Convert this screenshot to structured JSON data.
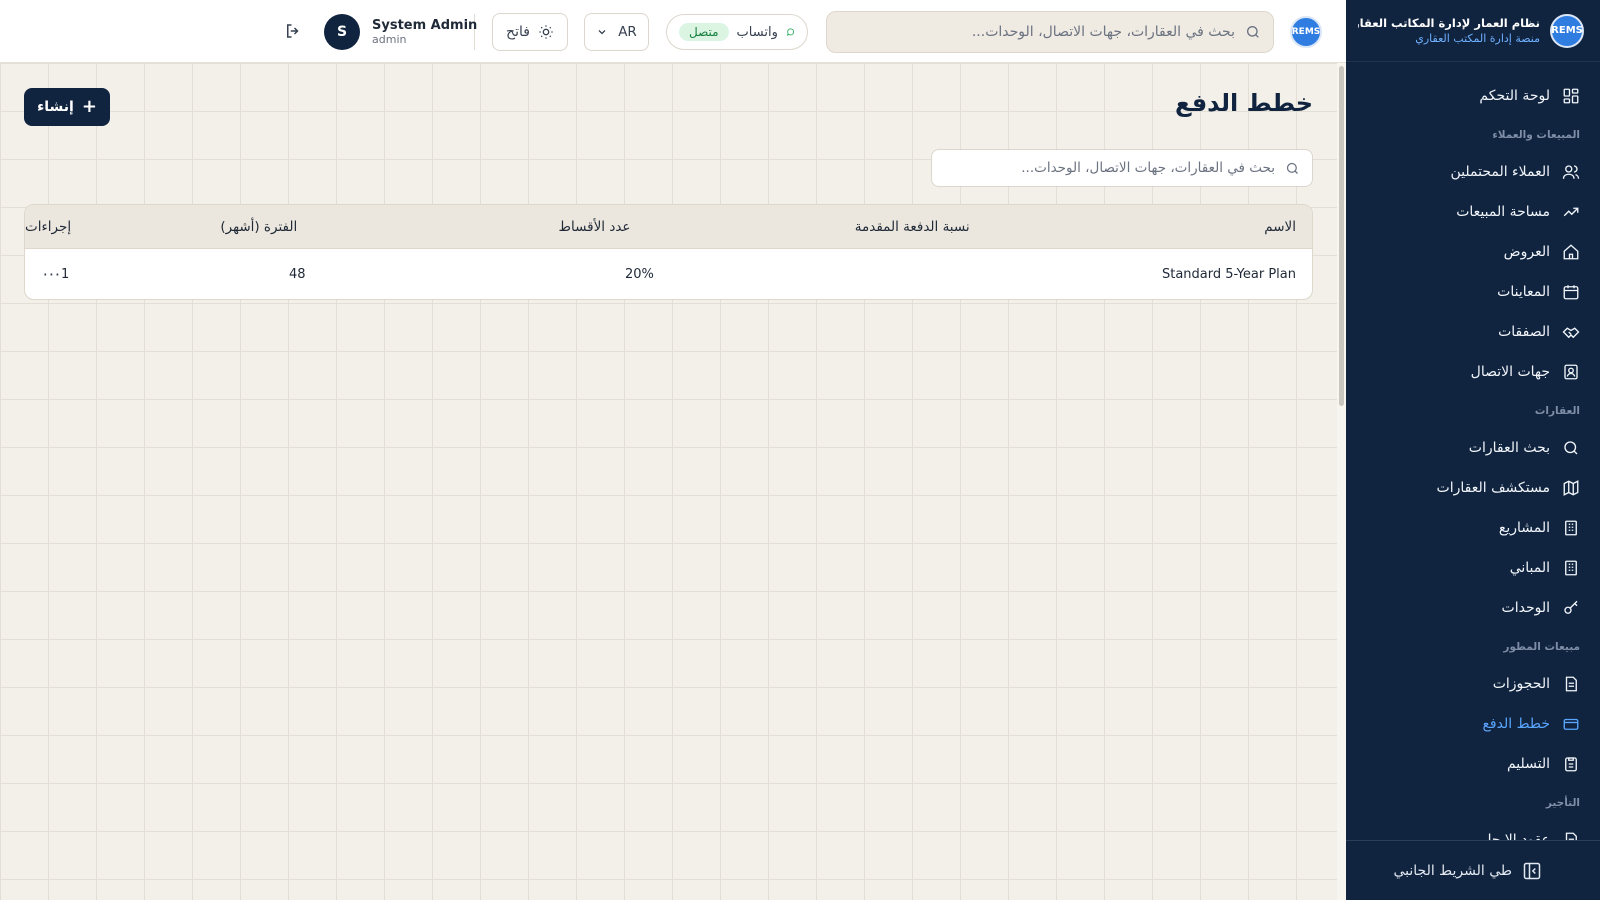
{
  "sidebar": {
    "brand_title": "نظام العمار لإدارة المكاتب العقارية",
    "brand_subtitle": "منصة إدارة المكتب العقاري",
    "logo_text": "REMS",
    "items": [
      {
        "type": "item",
        "label": "لوحة التحكم",
        "icon": "dashboard-icon"
      },
      {
        "type": "section",
        "label": "المبيعات والعملاء"
      },
      {
        "type": "item",
        "label": "العملاء المحتملين",
        "icon": "users-icon"
      },
      {
        "type": "item",
        "label": "مساحة المبيعات",
        "icon": "trending-icon"
      },
      {
        "type": "item",
        "label": "العروض",
        "icon": "home-icon"
      },
      {
        "type": "item",
        "label": "المعاينات",
        "icon": "calendar-icon"
      },
      {
        "type": "item",
        "label": "الصفقات",
        "icon": "handshake-icon"
      },
      {
        "type": "item",
        "label": "جهات الاتصال",
        "icon": "contact-icon"
      },
      {
        "type": "section",
        "label": "العقارات"
      },
      {
        "type": "item",
        "label": "بحث العقارات",
        "icon": "search-icon"
      },
      {
        "type": "item",
        "label": "مستكشف العقارات",
        "icon": "map-icon"
      },
      {
        "type": "item",
        "label": "المشاريع",
        "icon": "building-icon"
      },
      {
        "type": "item",
        "label": "المباني",
        "icon": "building-icon"
      },
      {
        "type": "item",
        "label": "الوحدات",
        "icon": "key-icon"
      },
      {
        "type": "section",
        "label": "مبيعات المطور"
      },
      {
        "type": "item",
        "label": "الحجوزات",
        "icon": "document-icon"
      },
      {
        "type": "item",
        "label": "خطط الدفع",
        "icon": "card-icon",
        "active": true
      },
      {
        "type": "item",
        "label": "التسليم",
        "icon": "clipboard-icon"
      },
      {
        "type": "section",
        "label": "التأجير"
      },
      {
        "type": "item",
        "label": "عقود الإيجار",
        "icon": "document-icon"
      }
    ],
    "collapse_label": "طي الشريط الجانبي"
  },
  "topbar": {
    "logo_text": "REMS",
    "search_placeholder": "بحث في العقارات، جهات الاتصال، الوحدات...",
    "whatsapp_label": "واتساب",
    "whatsapp_status": "متصل",
    "language": "AR",
    "theme_label": "فاتح",
    "user_initial": "S",
    "user_name": "System Admin",
    "user_role": "admin"
  },
  "main": {
    "title": "خطط الدفع",
    "create_label": "إنشاء",
    "search_placeholder": "بحث في العقارات، جهات الاتصال، الوحدات...",
    "table": {
      "headers": [
        "الاسم",
        "نسبة الدفعة المقدمة",
        "عدد الأقساط",
        "الفترة (أشهر)",
        "إجراءات"
      ],
      "rows": [
        [
          "Standard 5-Year Plan",
          "20%",
          "48",
          "1",
          "···"
        ]
      ]
    }
  },
  "colors": {
    "sidebar_bg": "#102440",
    "accent": "#5aa6ff",
    "status_green": "#15803d"
  }
}
